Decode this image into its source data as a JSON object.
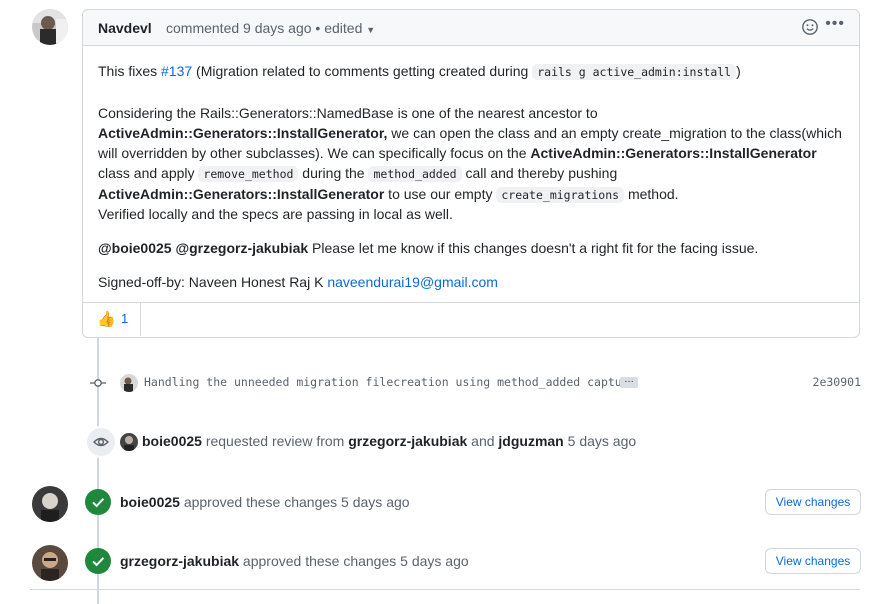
{
  "comment": {
    "author": "Navdevl",
    "meta": "commented 9 days ago • edited",
    "line1": {
      "prefix": "This fixes ",
      "issue_link": "#137",
      "middle": " (Migration related to comments getting created during ",
      "code": "rails g active_admin:install",
      "suffix": ")"
    },
    "para2": {
      "t1": "Considering the Rails::Generators::NamedBase is one of the nearest ancestor to ",
      "b1": "ActiveAdmin::Generators::InstallGenerator,",
      "t2": " we can open the class and an empty create_migration to the class(which will overridden by other subclasses). We can specifically focus on the ",
      "b2": "ActiveAdmin::Generators::InstallGenerator",
      "t3": " class and apply ",
      "c1": "remove_method",
      "t4": " during the ",
      "c2": "method_added",
      "t5": " call and thereby pushing ",
      "b3": "ActiveAdmin::Generators::InstallGenerator",
      "t6": " to use our empty ",
      "c3": "create_migrations",
      "t7": " method."
    },
    "para3": "Verified locally and the specs are passing in local as well.",
    "para4": {
      "mentions": "@boie0025 @grzegorz-jakubiak",
      "text": " Please let me know if this changes doesn't a right fit for the facing issue."
    },
    "signoff": {
      "text": "Signed-off-by: Naveen Honest Raj K ",
      "email": "naveendurai19@gmail.com"
    },
    "reaction": {
      "emoji": "👍",
      "count": "1"
    }
  },
  "commit": {
    "message": "Handling the unneeded migration filecreation using method_added captu…",
    "ellipsis": "…",
    "sha": "2e30901"
  },
  "review_request": {
    "requester": "boie0025",
    "t1": " requested review from ",
    "reviewer1": "grzegorz-jakubiak",
    "t2": " and ",
    "reviewer2": "jdguzman",
    "time": " 5 days ago"
  },
  "approvals": [
    {
      "user": "boie0025",
      "text": " approved these changes 5 days ago",
      "button": "View changes"
    },
    {
      "user": "grzegorz-jakubiak",
      "text": " approved these changes 5 days ago",
      "button": "View changes"
    }
  ],
  "colors": {
    "link": "#0969da",
    "success": "#1f883d",
    "border": "#d0d7de",
    "header_bg": "#f6f8fa"
  }
}
